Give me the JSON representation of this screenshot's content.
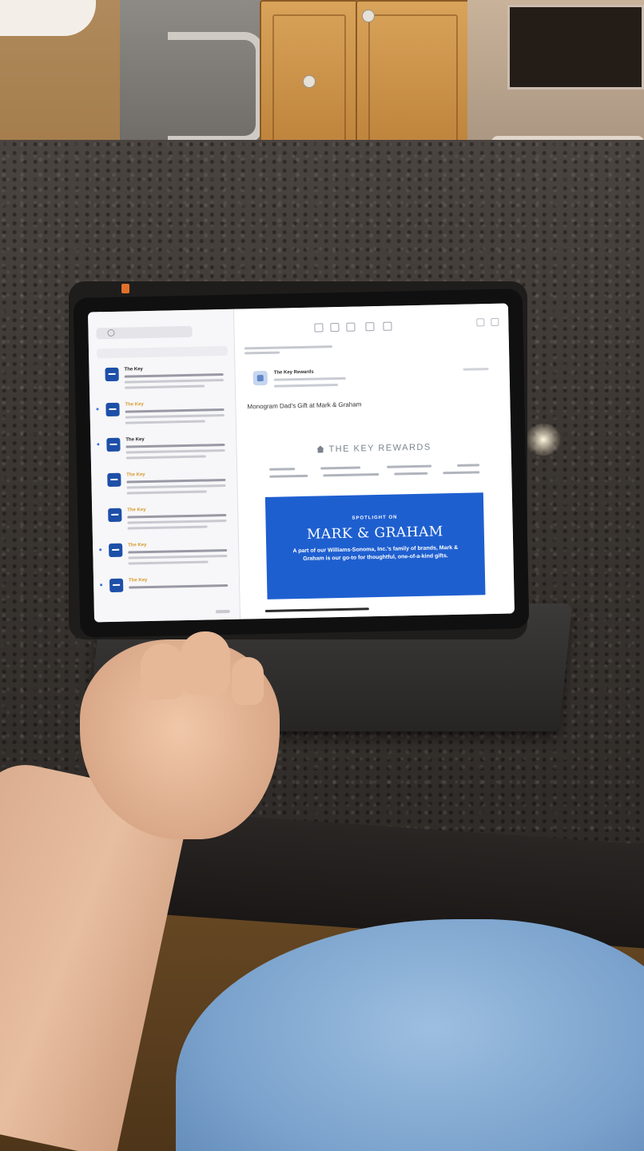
{
  "mail_app": {
    "list_pane": {
      "messages": [
        {
          "sender": "The Key",
          "sender_color": "#1e1e22",
          "unread": false
        },
        {
          "sender": "The Key",
          "sender_color": "#d79a2c",
          "unread": true
        },
        {
          "sender": "The Key",
          "sender_color": "#1e1e22",
          "unread": true
        },
        {
          "sender": "The Key",
          "sender_color": "#d79a2c",
          "unread": false
        },
        {
          "sender": "The Key",
          "sender_color": "#d79a2c",
          "unread": false
        },
        {
          "sender": "The Key",
          "sender_color": "#d79a2c",
          "unread": true
        },
        {
          "sender": "The Key",
          "sender_color": "#d79a2c",
          "unread": true
        }
      ]
    },
    "reader": {
      "sender_name": "The Key Rewards",
      "subject": "Monogram Dad's Gift at Mark & Graham",
      "header_logo": "THE KEY REWARDS",
      "banner": {
        "eyebrow": "SPOTLIGHT ON",
        "brand": "MARK & GRAHAM",
        "tagline": "A part of our Williams-Sonoma, Inc.'s family of brands, Mark & Graham is our go-to for thoughtful, one-of-a-kind gifts.",
        "color": "#1e5fd0"
      }
    }
  },
  "colors": {
    "accent_blue": "#1d4fa8",
    "unread_dot": "#3b6fd6"
  }
}
